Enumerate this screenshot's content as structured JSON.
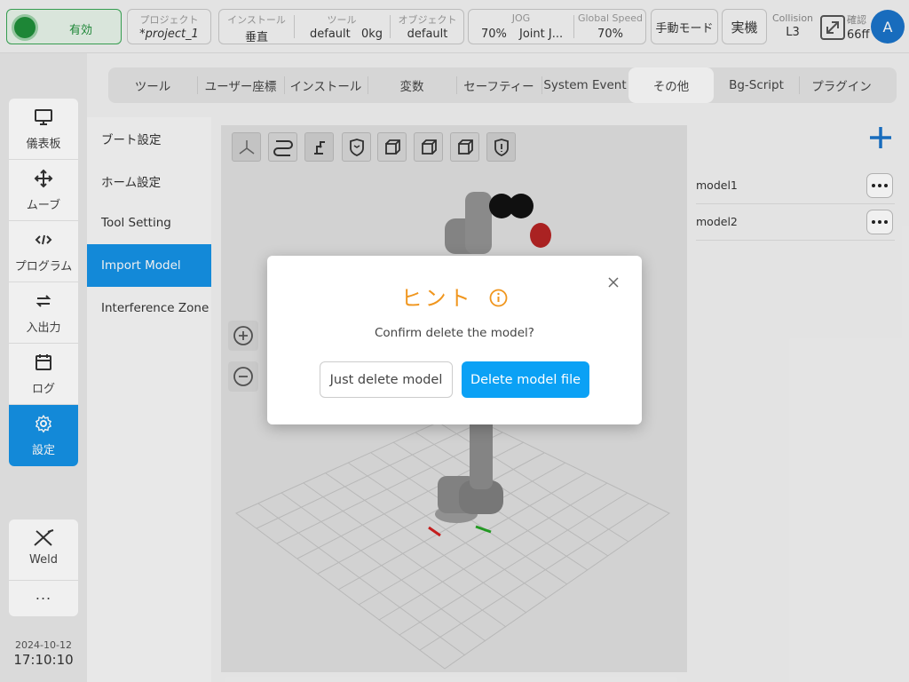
{
  "topbar": {
    "status_label": "有効",
    "project": {
      "label": "プロジェクト",
      "value": "*project_1"
    },
    "install": {
      "label": "インストール",
      "value": "垂直"
    },
    "tool": {
      "label": "ツール",
      "value_name": "default",
      "value_weight": "0kg"
    },
    "object": {
      "label": "オブジェクト",
      "value": "default"
    },
    "jog": {
      "label": "JOG",
      "speed": "70%",
      "mode": "Joint J..."
    },
    "global_speed": {
      "label": "Global Speed",
      "value": "70%"
    },
    "manual_mode": "手動モード",
    "real_machine": "実機",
    "collision": {
      "label": "Collision",
      "value": "L3"
    },
    "confirm": {
      "label": "確認",
      "value": "66ff"
    },
    "avatar": "A"
  },
  "sidebar": {
    "items": [
      {
        "label": "儀表板",
        "icon": "monitor-icon"
      },
      {
        "label": "ムーブ",
        "icon": "move-arrows-icon"
      },
      {
        "label": "プログラム",
        "icon": "code-icon"
      },
      {
        "label": "入出力",
        "icon": "swap-icon"
      },
      {
        "label": "ログ",
        "icon": "calendar-icon"
      },
      {
        "label": "設定",
        "icon": "gear-icon"
      }
    ],
    "extras": [
      {
        "label": "Weld",
        "icon": "weld-icon"
      },
      {
        "label": "...",
        "icon": "more-icon"
      }
    ],
    "date": "2024-10-12",
    "time": "17:10:10"
  },
  "tabs": [
    "ツール",
    "ユーザー座標",
    "インストール",
    "変数",
    "セーフティー",
    "System Event",
    "その他",
    "Bg-Script",
    "プラグイン"
  ],
  "active_tab": "その他",
  "submenu": [
    "ブート設定",
    "ホーム設定",
    "Tool Setting",
    "Import Model",
    "Interference Zone"
  ],
  "active_submenu": "Import Model",
  "models": [
    "model1",
    "model2"
  ],
  "dialog": {
    "title": "ヒント",
    "message": "Confirm delete the model?",
    "secondary_button": "Just delete model",
    "primary_button": "Delete model file"
  },
  "colors": {
    "accent": "#1592e6",
    "primary_button": "#0ba1f5",
    "warning": "#f0961e",
    "status_green": "#1f8f3a"
  }
}
